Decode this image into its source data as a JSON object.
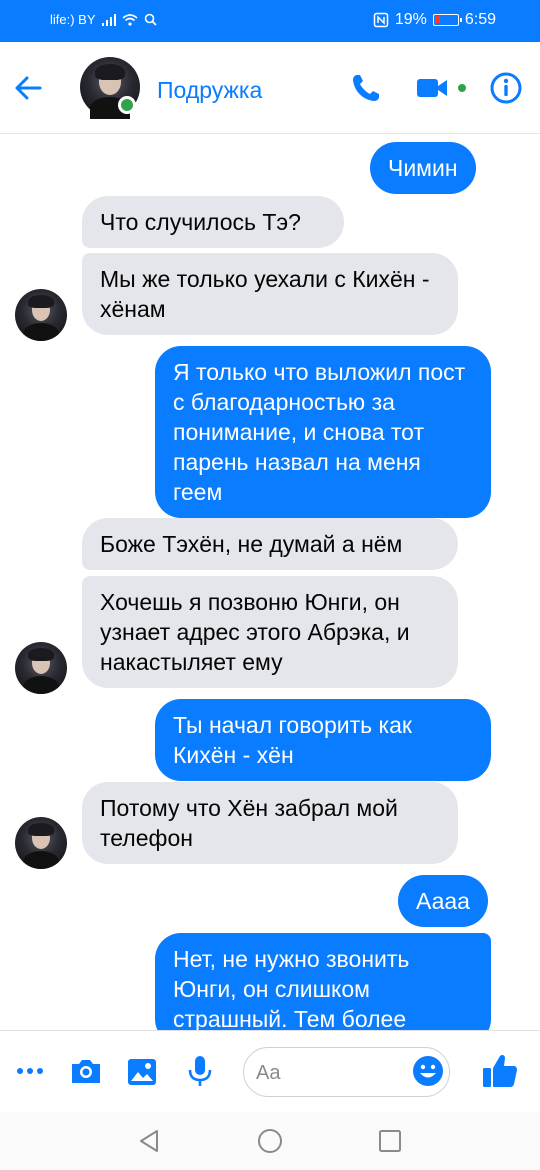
{
  "status_bar": {
    "carrier": "life:) BY",
    "battery": "19%",
    "time": "6:59"
  },
  "header": {
    "contact_name": "Подружка"
  },
  "messages": [
    {
      "side": "out",
      "text": "Чимин"
    },
    {
      "side": "in",
      "text": "Что случилось Тэ?"
    },
    {
      "side": "in",
      "text": "Мы же только уехали с Кихён - хёнам"
    },
    {
      "side": "out",
      "text": "Я только что выложил пост с благодарностью за понимание, и снова тот парень назвал на меня геем"
    },
    {
      "side": "in",
      "text": "Боже Тэхён, не думай а нём"
    },
    {
      "side": "in",
      "text": "Хочешь я позвоню Юнги, он узнает адрес этого Абрэка, и накастыляет ему"
    },
    {
      "side": "out",
      "text": "Ты начал говорить как Кихён - хён"
    },
    {
      "side": "in",
      "text": "Потому что Хён забрал мой телефон"
    },
    {
      "side": "out",
      "text": "Аааа"
    },
    {
      "side": "out",
      "text": "Нет, не нужно звонить Юнги, он слишком страшный. Тем более"
    }
  ],
  "composer": {
    "placeholder": "Aa"
  },
  "colors": {
    "accent": "#0a7cff",
    "incoming_bubble": "#e4e6eb",
    "online": "#31a24c"
  }
}
